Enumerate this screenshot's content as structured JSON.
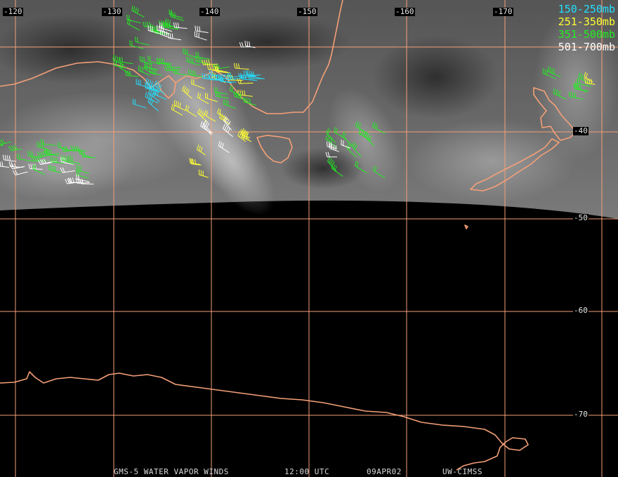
{
  "longitude_labels": [
    "-120",
    "-130",
    "-140",
    "-150",
    "-160",
    "-170"
  ],
  "latitude_labels": [
    "-40",
    "-50",
    "-60",
    "-70"
  ],
  "legend": [
    {
      "label": "150-250mb",
      "color": "#22e0ff"
    },
    {
      "label": "251-350mb",
      "color": "#ffff33"
    },
    {
      "label": "351-500mb",
      "color": "#22ee22"
    },
    {
      "label": "501-700mb",
      "color": "#ffffff"
    }
  ],
  "footer": {
    "product": "GMS-5 WATER VAPOR WINDS",
    "time": "12:00 UTC",
    "date": "09APR02",
    "source": "UW-CIMSS"
  },
  "colors": {
    "coastline": "#f5a078",
    "grid": "#f5a078",
    "background": "#000000"
  }
}
